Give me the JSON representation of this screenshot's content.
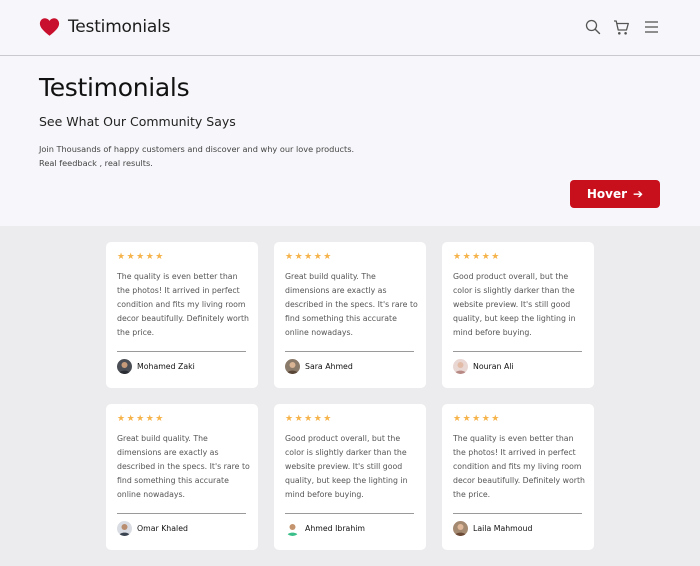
{
  "colors": {
    "accent": "#c8101d",
    "star": "#f5b34a",
    "page_bg": "#ecebed",
    "header_bg": "#f7f7fb"
  },
  "navbar": {
    "logo_icon": "heart-icon",
    "brand_name": "Testimonials",
    "icons": [
      "search-icon",
      "cart-icon",
      "menu-icon"
    ]
  },
  "hero": {
    "title": "Testimonials",
    "subtitle": "See What Our Community Says",
    "description_line1": "Join Thousands of happy customers and discover and why our love products.",
    "description_line2": "Real feedback , real results.",
    "button_label": "Hover",
    "button_icon": "arrow-right-icon"
  },
  "testimonials": [
    {
      "rating": 5,
      "stars": "★★★★★",
      "text": "The quality is even better than the photos! It arrived in perfect condition and fits my living room decor beautifully. Definitely worth the price.",
      "author": "Mohamed Zaki"
    },
    {
      "rating": 5,
      "stars": "★★★★★",
      "text": "Great build quality. The dimensions are exactly as described in the specs. It's rare to find something this accurate online nowadays.",
      "author": "Sara Ahmed"
    },
    {
      "rating": 5,
      "stars": "★★★★★",
      "text": "Good product overall, but the color is slightly darker than the website preview. It's still good quality, but keep the lighting in mind before buying.",
      "author": "Nouran Ali"
    },
    {
      "rating": 5,
      "stars": "★★★★★",
      "text": "Great build quality. The dimensions are exactly as described in the specs. It's rare to find something this accurate online nowadays.",
      "author": "Omar Khaled"
    },
    {
      "rating": 5,
      "stars": "★★★★★",
      "text": "Good product overall, but the color is slightly darker than the website preview. It's still good quality, but keep the lighting in mind before buying.",
      "author": "Ahmed Ibrahim"
    },
    {
      "rating": 5,
      "stars": "★★★★★",
      "text": "The quality is even better than the photos! It arrived in perfect condition and fits my living room decor beautifully. Definitely worth the price.",
      "author": "Laila Mahmoud"
    }
  ]
}
